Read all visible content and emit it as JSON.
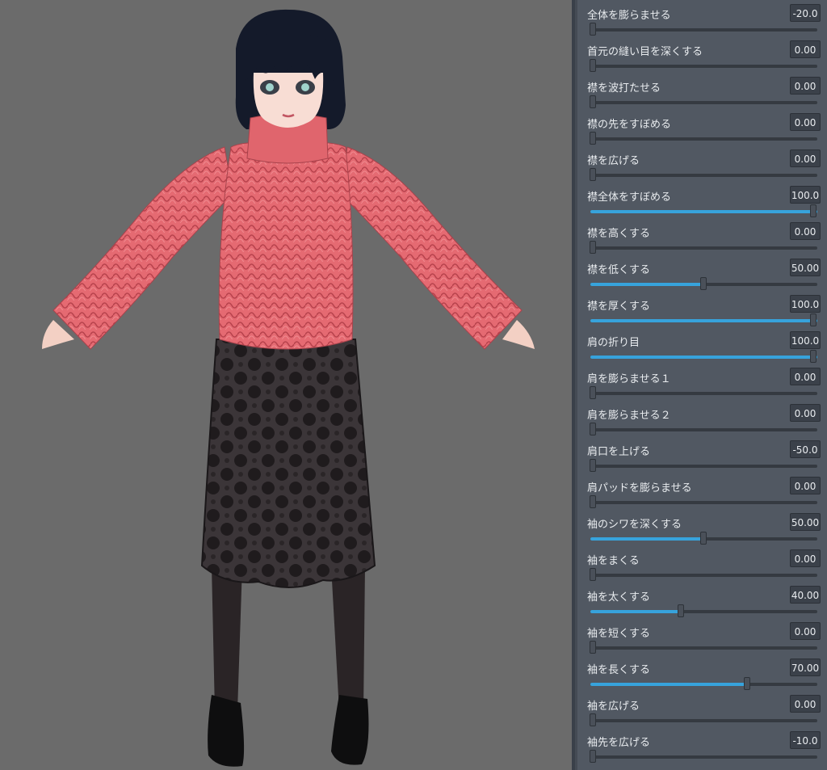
{
  "sliders": [
    {
      "label": "全体を膨らませる",
      "value": "-20.0",
      "level": 0.0
    },
    {
      "label": "首元の縫い目を深くする",
      "value": "0.00",
      "level": 0.0
    },
    {
      "label": "襟を波打たせる",
      "value": "0.00",
      "level": 0.0
    },
    {
      "label": "襟の先をすぼめる",
      "value": "0.00",
      "level": 0.0
    },
    {
      "label": "襟を広げる",
      "value": "0.00",
      "level": 0.0
    },
    {
      "label": "襟全体をすぼめる",
      "value": "100.0",
      "level": 1.0
    },
    {
      "label": "襟を高くする",
      "value": "0.00",
      "level": 0.0
    },
    {
      "label": "襟を低くする",
      "value": "50.00",
      "level": 0.5
    },
    {
      "label": "襟を厚くする",
      "value": "100.0",
      "level": 1.0
    },
    {
      "label": "肩の折り目",
      "value": "100.0",
      "level": 1.0
    },
    {
      "label": "肩を膨らませる１",
      "value": "0.00",
      "level": 0.0
    },
    {
      "label": "肩を膨らませる２",
      "value": "0.00",
      "level": 0.0
    },
    {
      "label": "肩口を上げる",
      "value": "-50.0",
      "level": 0.0
    },
    {
      "label": "肩パッドを膨らませる",
      "value": "0.00",
      "level": 0.0
    },
    {
      "label": "袖のシワを深くする",
      "value": "50.00",
      "level": 0.5
    },
    {
      "label": "袖をまくる",
      "value": "0.00",
      "level": 0.0
    },
    {
      "label": "袖を太くする",
      "value": "40.00",
      "level": 0.4
    },
    {
      "label": "袖を短くする",
      "value": "0.00",
      "level": 0.0
    },
    {
      "label": "袖を長くする",
      "value": "70.00",
      "level": 0.7
    },
    {
      "label": "袖を広げる",
      "value": "0.00",
      "level": 0.0
    },
    {
      "label": "袖先を広げる",
      "value": "-10.0",
      "level": 0.0
    }
  ],
  "colors": {
    "viewport_bg": "#6b6b6b",
    "panel_bg": "#515862",
    "slider_fill": "#37a3dc",
    "sweater": "#e8666f",
    "skirt": "#242022",
    "hair": "#141a2a"
  }
}
